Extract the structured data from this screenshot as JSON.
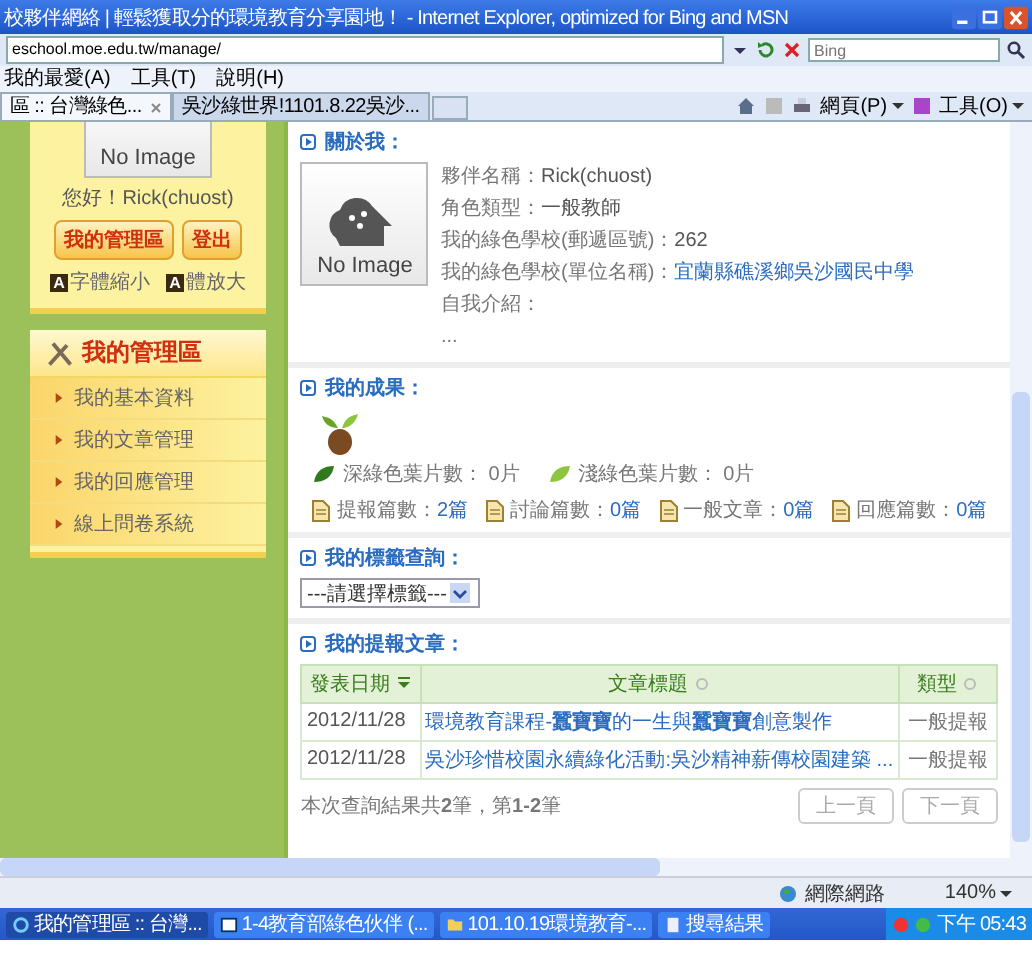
{
  "window": {
    "title": "校夥伴網絡 | 輕鬆獲取分的環境教育分享園地！ - Internet Explorer, optimized for Bing and MSN"
  },
  "address_bar": {
    "url": "eschool.moe.edu.tw/manage/",
    "search_placeholder": "Bing"
  },
  "menu": [
    "我的最愛(A)",
    "工具(T)",
    "說明(H)"
  ],
  "tabs": [
    {
      "label": "區 :: 台灣綠色...",
      "selected": true
    },
    {
      "label": "吳沙綠世界!1101.8.22吳沙...",
      "selected": false
    }
  ],
  "command_bar": [
    "網頁(P)",
    "工具(O)"
  ],
  "sidebar": {
    "photo": "No Image",
    "greeting": "您好！Rick(chuost)",
    "buttons": [
      "我的管理區",
      "登出"
    ],
    "font_controls": [
      {
        "icon": "A",
        "label": "字體縮小"
      },
      {
        "icon": "A",
        "label": "體放大"
      }
    ],
    "menu_title": "我的管理區",
    "menu_items": [
      "我的基本資料",
      "我的文章管理",
      "我的回應管理",
      "線上問卷系統"
    ]
  },
  "about": {
    "title": "關於我：",
    "photo": "No Image",
    "fields": [
      {
        "label": "夥伴名稱：",
        "value": "Rick(chuost)",
        "kind": "text"
      },
      {
        "label": "角色類型：",
        "value": "一般教師",
        "kind": "text"
      },
      {
        "label": "我的綠色學校(郵遞區號)：",
        "value": "262",
        "kind": "text"
      },
      {
        "label": "我的綠色學校(單位名稱)：",
        "value": "宜蘭縣礁溪鄉吳沙國民中學",
        "kind": "link"
      }
    ],
    "intro_label": "自我介紹：",
    "intro_text": "..."
  },
  "results": {
    "title": "我的成果：",
    "leaves": [
      {
        "label": "深綠色葉片數：",
        "value": "0片",
        "color": "#2f7a1c"
      },
      {
        "label": "淺綠色葉片數：",
        "value": "0片",
        "color": "#8cc63f"
      }
    ],
    "counts": [
      {
        "label": "提報篇數：",
        "value": "2篇"
      },
      {
        "label": "討論篇數：",
        "value": "0篇"
      },
      {
        "label": "一般文章：",
        "value": "0篇"
      },
      {
        "label": "回應篇數：",
        "value": "0篇"
      }
    ]
  },
  "tags": {
    "title": "我的標籤查詢：",
    "select": "---請選擇標籤---"
  },
  "articles": {
    "title": "我的提報文章：",
    "columns": [
      {
        "label": "發表日期",
        "sorted": true
      },
      {
        "label": "文章標題",
        "sorted": false
      },
      {
        "label": "類型",
        "sorted": false
      }
    ],
    "rows": [
      {
        "date": "2012/11/28",
        "title": "環境教育課程-**蠶寶寶**的一生與**蠶寶寶**創意製作",
        "type": "一般提報"
      },
      {
        "date": "2012/11/28",
        "title": "吳沙珍惜校園永續綠化活動:吳沙精神薪傳校園建築 ...",
        "type": "一般提報"
      }
    ],
    "summary": "本次查詢結果共**2**筆，第**1-2**筆",
    "pager": [
      {
        "label": "上一頁",
        "disabled": true
      },
      {
        "label": "下一頁",
        "disabled": true
      }
    ]
  },
  "status_bar": {
    "zone": "網際網路",
    "zoom": "140%"
  },
  "taskbar": {
    "items": [
      {
        "label": "我的管理區 :: 台灣...",
        "selected": true,
        "kind": "browser"
      },
      {
        "label": "1-4教育部綠色伙伴 (...",
        "selected": false,
        "kind": "window"
      },
      {
        "label": "101.10.19環境教育-...",
        "selected": false,
        "kind": "folder"
      },
      {
        "label": "搜尋結果",
        "selected": false,
        "kind": "document"
      }
    ],
    "clock": "下午 05:43"
  }
}
